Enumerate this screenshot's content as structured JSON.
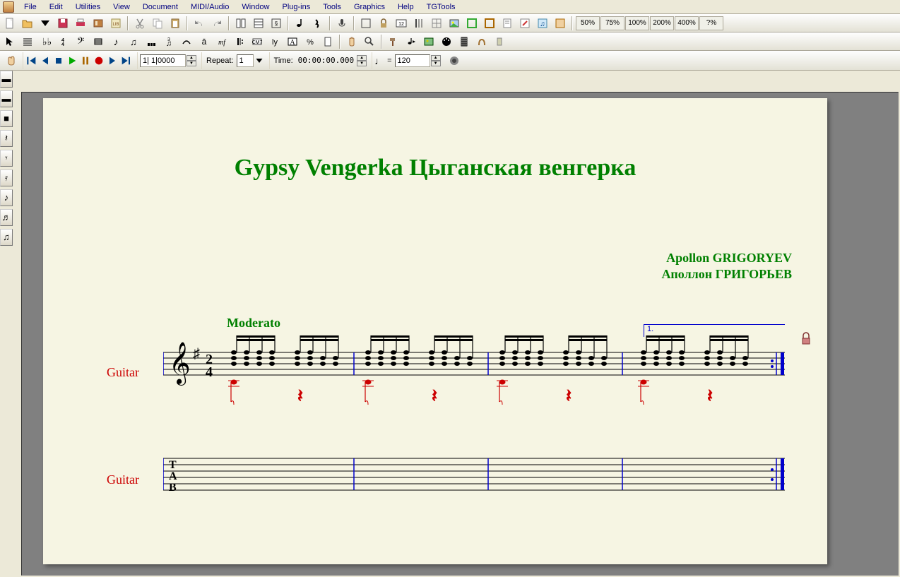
{
  "menu": [
    "File",
    "Edit",
    "Utilities",
    "View",
    "Document",
    "MIDI/Audio",
    "Window",
    "Plug-ins",
    "Tools",
    "Graphics",
    "Help",
    "TGTools"
  ],
  "zoom_buttons": [
    "50%",
    "75%",
    "100%",
    "200%",
    "400%",
    "?%"
  ],
  "transport": {
    "position": "1| 1|0000",
    "repeat_label": "Repeat:",
    "repeat_value": "1",
    "time_label": "Time:",
    "time_value": "00:00:00.000",
    "tempo_equals": "=",
    "tempo_value": "120"
  },
  "score": {
    "title": "Gypsy Vengerka      Цыганская венгерка",
    "composer_en": "Apollon GRIGORYEV",
    "composer_ru": "Аполлон ГРИГОРЬЕВ",
    "tempo_mark": "Moderato",
    "instrument1": "Guitar",
    "instrument2": "Guitar",
    "volta_label": "1.",
    "time_sig_top": "2",
    "time_sig_bottom": "4",
    "tab_label": "TAB"
  },
  "left_palette": [
    "▬",
    "▬",
    "■",
    "𝄽",
    "𝄾",
    "𝄿",
    "♪",
    "♬",
    "♫"
  ]
}
